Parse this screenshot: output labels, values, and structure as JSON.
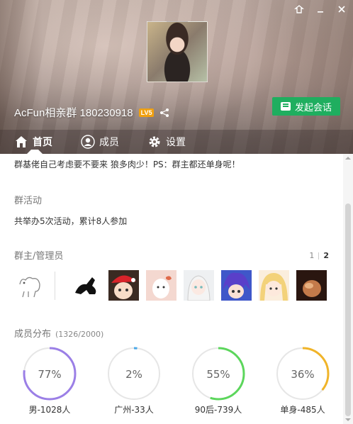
{
  "header": {
    "group_name": "AcFun相亲群 180230918",
    "level": "LV5",
    "start_chat_label": "发起会话"
  },
  "tabs": [
    {
      "label": "首页"
    },
    {
      "label": "成员"
    },
    {
      "label": "设置"
    }
  ],
  "notice": "群基佬自己考虑要不要来 狼多肉少！PS：群主都还单身呢！",
  "activity": {
    "title": "群活动",
    "text": "共举办5次活动，累计8人参加"
  },
  "admins": {
    "title": "群主/管理员",
    "page_1": "1",
    "page_2": "2"
  },
  "members": {
    "title": "成员分布",
    "count": "(1326/2000)"
  },
  "stats": [
    {
      "pct_label": "77%",
      "value": 77,
      "label": "男-1028人",
      "color": "#9b7fe6"
    },
    {
      "pct_label": "2%",
      "value": 2,
      "label": "广州-33人",
      "color": "#4aa8e8"
    },
    {
      "pct_label": "55%",
      "value": 55,
      "label": "90后-739人",
      "color": "#5cd65c"
    },
    {
      "pct_label": "36%",
      "value": 36,
      "label": "单身-485人",
      "color": "#f0b429"
    }
  ],
  "colors": {
    "accent_green": "#1fae5f",
    "level_badge": "#f0a010"
  }
}
